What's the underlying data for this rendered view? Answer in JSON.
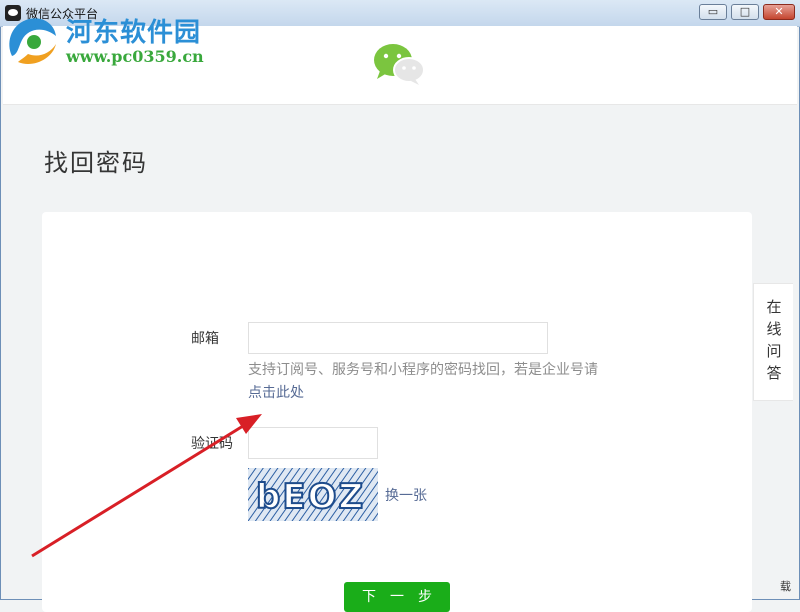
{
  "window": {
    "title": "微信公众平台",
    "minimize_symbol": "▭",
    "maximize_symbol": "□",
    "close_symbol": "✕"
  },
  "watermark": {
    "title": "河东软件园",
    "url": "www.pc0359.cn"
  },
  "page": {
    "title": "找回密码"
  },
  "form": {
    "email_label": "邮箱",
    "email_value": "",
    "email_hint_line1": "支持订阅号、服务号和小程序的密码找回，若是企业号请",
    "email_hint_line2": "点击此处",
    "captcha_label": "验证码",
    "captcha_value": "",
    "captcha_text": "bEOZ",
    "refresh_label": "换一张",
    "next_button": "下一步"
  },
  "side": {
    "online_qa": "在线问答"
  },
  "corner_text": "载",
  "colors": {
    "accent_green": "#1aad19",
    "link_blue": "#576b95",
    "arrow_red": "#d81f26",
    "watermark_blue": "#2b8fd6",
    "watermark_green": "#39a83c"
  },
  "icons": {
    "app": "wechat-app-icon",
    "logo": "wechat-logo-icon",
    "watermark": "watermark-logo-icon"
  }
}
